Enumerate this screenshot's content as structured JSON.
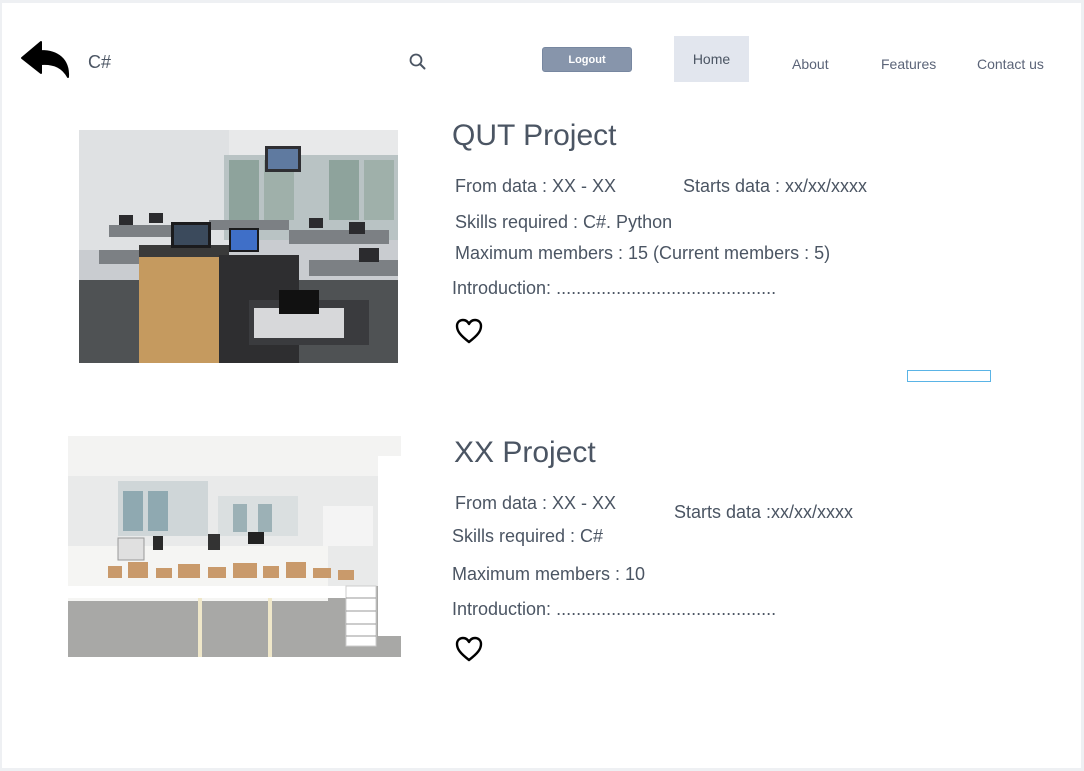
{
  "header": {
    "search_text": "C#",
    "logout_label": "Logout",
    "nav": {
      "home": "Home",
      "about": "About",
      "features": "Features",
      "contact": "Contact us"
    }
  },
  "projects": [
    {
      "title": "QUT Project",
      "from": "From data : XX - XX",
      "starts": "Starts data :  xx/xx/xxxx",
      "skills": "Skills required :  C#. Python",
      "members": "Maximum members : 15  (Current members : 5)",
      "intro": "Introduction: ............................................"
    },
    {
      "title": "XX Project",
      "from": "From data : XX - XX",
      "starts": "Starts data :xx/xx/xxxx",
      "skills": "Skills required : C#",
      "members": "Maximum members : 10",
      "intro": "Introduction: ............................................"
    }
  ],
  "icons": {
    "back": "back-arrow-icon",
    "search": "search-icon",
    "favorite": "heart-icon"
  },
  "colors": {
    "logout_button": "#8795ab",
    "home_active_bg": "#e2e6ee",
    "outline_box": "#5ab4e6"
  }
}
